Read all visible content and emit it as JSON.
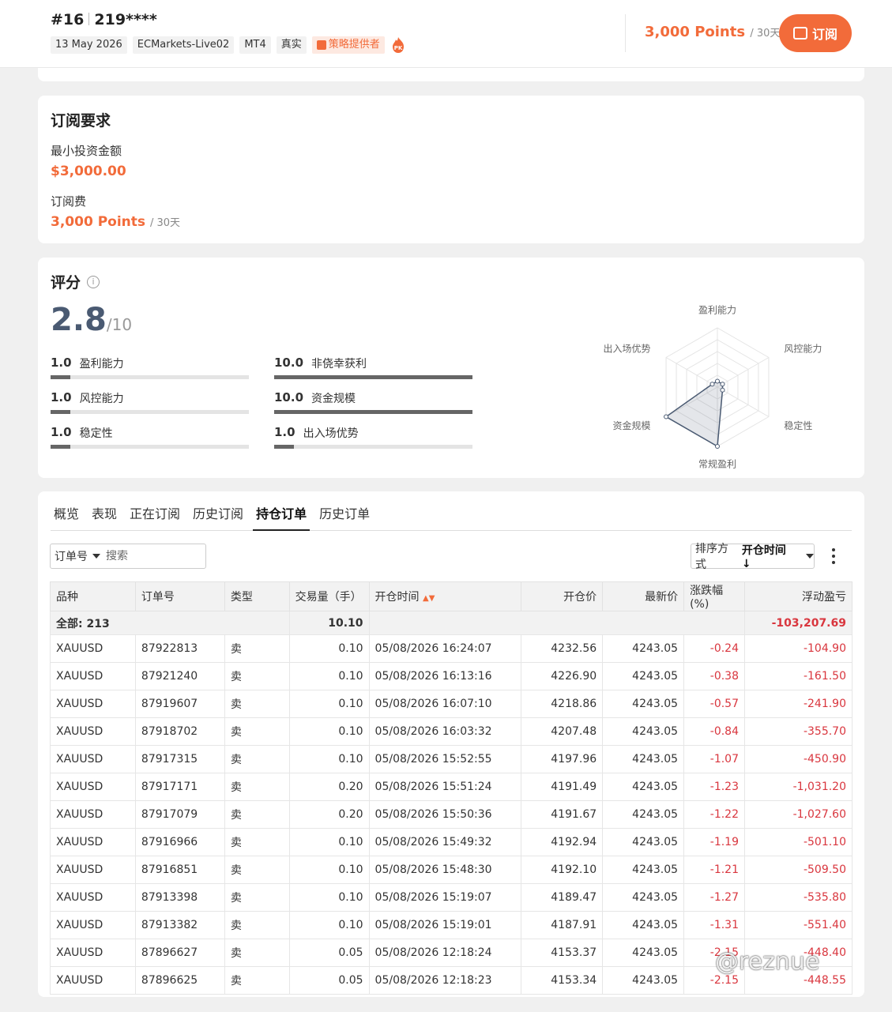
{
  "header": {
    "rank": "#16",
    "account": "219****",
    "tags": [
      "13 May 2026",
      "ECMarkets-Live02",
      "MT4",
      "真实"
    ],
    "provider_tag": "策略提供者",
    "price": "3,000 Points",
    "price_period": "/ 30天",
    "subscribe_label": "订阅",
    "accent_color": "#f26b3a"
  },
  "requirements": {
    "title": "订阅要求",
    "min_invest_label": "最小投资金额",
    "min_invest_value": "$3,000.00",
    "fee_label": "订阅费",
    "fee_value": "3,000 Points",
    "fee_period": "/ 30天"
  },
  "score": {
    "title": "评分",
    "info_glyph": "i",
    "value": "2.8",
    "denominator": "/10",
    "metrics": [
      {
        "value": "1.0",
        "label": "盈利能力",
        "fraction": 0.1
      },
      {
        "value": "10.0",
        "label": "非侥幸获利",
        "fraction": 1.0
      },
      {
        "value": "1.0",
        "label": "风控能力",
        "fraction": 0.1
      },
      {
        "value": "10.0",
        "label": "资金规模",
        "fraction": 1.0
      },
      {
        "value": "1.0",
        "label": "稳定性",
        "fraction": 0.1
      },
      {
        "value": "1.0",
        "label": "出入场优势",
        "fraction": 0.1
      }
    ],
    "radar": {
      "axes": [
        "盈利能力",
        "风控能力",
        "稳定性",
        "常规盈利",
        "资金规模",
        "出入场优势"
      ],
      "values": [
        1.0,
        1.0,
        1.0,
        10.0,
        10.0,
        1.0
      ],
      "max": 10
    }
  },
  "orders": {
    "tabs": [
      "概览",
      "表现",
      "正在订阅",
      "历史订阅",
      "持仓订单",
      "历史订单"
    ],
    "active_tab": 4,
    "filter_label": "订单号",
    "search_placeholder": "搜索",
    "sort_prefix": "排序方式",
    "sort_value": "开仓时间 ↓",
    "columns": [
      "品种",
      "订单号",
      "类型",
      "交易量（手）",
      "开仓时间",
      "开仓价",
      "最新价",
      "涨跌幅(%)",
      "浮动盈亏"
    ],
    "summary": {
      "label": "全部: 213",
      "volume": "10.10",
      "pnl": "-103,207.69"
    },
    "rows": [
      [
        "XAUUSD",
        "87922813",
        "卖",
        "0.10",
        "05/08/2026 16:24:07",
        "4232.56",
        "4243.05",
        "-0.24",
        "-104.90"
      ],
      [
        "XAUUSD",
        "87921240",
        "卖",
        "0.10",
        "05/08/2026 16:13:16",
        "4226.90",
        "4243.05",
        "-0.38",
        "-161.50"
      ],
      [
        "XAUUSD",
        "87919607",
        "卖",
        "0.10",
        "05/08/2026 16:07:10",
        "4218.86",
        "4243.05",
        "-0.57",
        "-241.90"
      ],
      [
        "XAUUSD",
        "87918702",
        "卖",
        "0.10",
        "05/08/2026 16:03:32",
        "4207.48",
        "4243.05",
        "-0.84",
        "-355.70"
      ],
      [
        "XAUUSD",
        "87917315",
        "卖",
        "0.10",
        "05/08/2026 15:52:55",
        "4197.96",
        "4243.05",
        "-1.07",
        "-450.90"
      ],
      [
        "XAUUSD",
        "87917171",
        "卖",
        "0.20",
        "05/08/2026 15:51:24",
        "4191.49",
        "4243.05",
        "-1.23",
        "-1,031.20"
      ],
      [
        "XAUUSD",
        "87917079",
        "卖",
        "0.20",
        "05/08/2026 15:50:36",
        "4191.67",
        "4243.05",
        "-1.22",
        "-1,027.60"
      ],
      [
        "XAUUSD",
        "87916966",
        "卖",
        "0.10",
        "05/08/2026 15:49:32",
        "4192.94",
        "4243.05",
        "-1.19",
        "-501.10"
      ],
      [
        "XAUUSD",
        "87916851",
        "卖",
        "0.10",
        "05/08/2026 15:48:30",
        "4192.10",
        "4243.05",
        "-1.21",
        "-509.50"
      ],
      [
        "XAUUSD",
        "87913398",
        "卖",
        "0.10",
        "05/08/2026 15:19:07",
        "4189.47",
        "4243.05",
        "-1.27",
        "-535.80"
      ],
      [
        "XAUUSD",
        "87913382",
        "卖",
        "0.10",
        "05/08/2026 15:19:01",
        "4187.91",
        "4243.05",
        "-1.31",
        "-551.40"
      ],
      [
        "XAUUSD",
        "87896627",
        "卖",
        "0.05",
        "05/08/2026 12:18:24",
        "4153.37",
        "4243.05",
        "-2.15",
        "-448.40"
      ],
      [
        "XAUUSD",
        "87896625",
        "卖",
        "0.05",
        "05/08/2026 12:18:23",
        "4153.34",
        "4243.05",
        "-2.15",
        "-448.55"
      ]
    ]
  },
  "watermark": "@reznue"
}
